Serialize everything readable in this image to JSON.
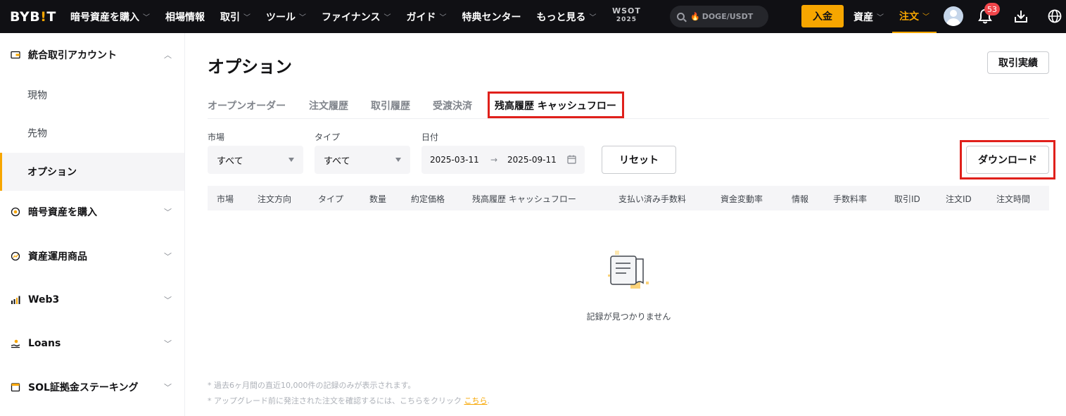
{
  "nav": {
    "logo_main": "BYB",
    "logo_accent": "!",
    "logo_end": "T",
    "items": [
      {
        "label": "暗号資産を購入",
        "chevron": true
      },
      {
        "label": "相場情報",
        "chevron": false
      },
      {
        "label": "取引",
        "chevron": true
      },
      {
        "label": "ツール",
        "chevron": true
      },
      {
        "label": "ファイナンス",
        "chevron": true
      },
      {
        "label": "ガイド",
        "chevron": true
      },
      {
        "label": "特典センター",
        "chevron": false
      },
      {
        "label": "もっと見る",
        "chevron": true
      }
    ],
    "wsot_line1": "WSOT",
    "wsot_line2": "2025",
    "search_placeholder": "DOGE/USDT",
    "deposit_label": "入金",
    "assets_label": "資産",
    "orders_label": "注文",
    "notification_count": "53",
    "accent_color": "#f7a600"
  },
  "sidebar": {
    "groups": [
      {
        "label": "統合取引アカウント",
        "icon": "wallet-icon",
        "expanded": true
      },
      {
        "label": "暗号資産を購入",
        "icon": "coin-icon",
        "expanded": false
      },
      {
        "label": "資産運用商品",
        "icon": "chart-coin-icon",
        "expanded": false
      },
      {
        "label": "Web3",
        "icon": "bars-icon",
        "expanded": false
      },
      {
        "label": "Loans",
        "icon": "hand-coin-icon",
        "expanded": false
      },
      {
        "label": "SOL証拠金ステーキング",
        "icon": "calendar-icon",
        "expanded": false
      }
    ],
    "sub_items": [
      {
        "label": "現物",
        "active": false
      },
      {
        "label": "先物",
        "active": false
      },
      {
        "label": "オプション",
        "active": true
      }
    ]
  },
  "main": {
    "title": "オプション",
    "trade_history_button": "取引実績",
    "tabs": [
      {
        "label": "オープンオーダー",
        "active": false
      },
      {
        "label": "注文履歴",
        "active": false
      },
      {
        "label": "取引履歴",
        "active": false
      },
      {
        "label": "受渡決済",
        "active": false
      },
      {
        "label": "残高履歴 キャッシュフロー",
        "active": true
      }
    ],
    "filters": {
      "market_label": "市場",
      "market_value": "すべて",
      "type_label": "タイプ",
      "type_value": "すべて",
      "date_label": "日付",
      "date_from": "2025-03-11",
      "date_to": "2025-09-11",
      "date_arrow": "→",
      "reset_label": "リセット",
      "download_label": "ダウンロード"
    },
    "columns": [
      "市場",
      "注文方向",
      "タイプ",
      "数量",
      "約定価格",
      "残高履歴 キャッシュフロー",
      "支払い済み手数料",
      "資金変動率",
      "情報",
      "手数料率",
      "取引ID",
      "注文ID",
      "注文時間"
    ],
    "empty_text": "記録が見つかりません",
    "note1": "* 過去6ヶ月間の直近10,000件の記録のみが表示されます。",
    "note2": "* アップグレード前に発注された注文を確認するには、こちらをクリック",
    "note2_link": "こちら",
    "note2_end": "."
  }
}
